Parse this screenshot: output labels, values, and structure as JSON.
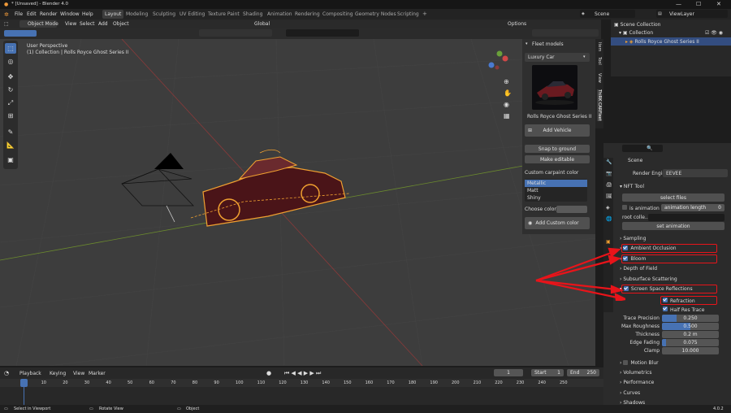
{
  "title": "* [Unsaved] - Blender 4.0",
  "menu": [
    "File",
    "Edit",
    "Render",
    "Window",
    "Help"
  ],
  "workspaces": [
    "Layout",
    "Modeling",
    "Sculpting",
    "UV Editing",
    "Texture Paint",
    "Shading",
    "Animation",
    "Rendering",
    "Compositing",
    "Geometry Nodes",
    "Scripting"
  ],
  "scene_label": "Scene",
  "viewlayer_label": "ViewLayer",
  "viewport": {
    "mode": "Object Mode",
    "menus": [
      "View",
      "Select",
      "Add",
      "Object"
    ],
    "transform": "Global",
    "options": "Options",
    "info_line1": "User Perspective",
    "info_line2": "(1) Collection | Rolls Royce Ghost Series II"
  },
  "npanel": {
    "header": "Fleet models",
    "dropdown": "Luxury Car",
    "car_name": "Rolls Royce Ghost Series II",
    "add_vehicle": "Add Vehicle",
    "snap": "Snap to ground",
    "editable": "Make editable",
    "paint_label": "Custom carpaint color",
    "paints": [
      "Metallic",
      "Matt",
      "Shiny"
    ],
    "choose_color": "Choose color:",
    "add_custom": "Add Custom color"
  },
  "vtabs": [
    "Item",
    "Tool",
    "View",
    "ThiRK CARFleet"
  ],
  "outliner": {
    "root": "Scene Collection",
    "collection": "Collection",
    "object": "Rolls Royce Ghost Series II"
  },
  "props": {
    "scene": "Scene",
    "engine_label": "Render Engine",
    "engine": "EEVEE",
    "nft_header": "NFT Tool",
    "select_files": "select files",
    "is_animation": "is animation",
    "anim_length_label": "animation length",
    "anim_length": "0",
    "root_coll": "root colle...",
    "set_animation": "set animation",
    "sections": [
      "Sampling",
      "Ambient Occlusion",
      "Bloom",
      "Depth of Field",
      "Subsurface Scattering",
      "Screen Space Reflections"
    ],
    "refraction": "Refraction",
    "half_res": "Half Res Trace",
    "fields": [
      {
        "label": "Trace Precision",
        "value": "0.250",
        "fill": 0.25
      },
      {
        "label": "Max Roughness",
        "value": "0.500",
        "fill": 0.5
      },
      {
        "label": "Thickness",
        "value": "0.2 m",
        "fill": 0
      },
      {
        "label": "Edge Fading",
        "value": "0.075",
        "fill": 0.075
      },
      {
        "label": "Clamp",
        "value": "10.000",
        "fill": 0
      }
    ],
    "sections2": [
      "Motion Blur",
      "Volumetrics",
      "Performance",
      "Curves",
      "Shadows"
    ]
  },
  "timeline": {
    "menus": [
      "Playback",
      "Keying",
      "View",
      "Marker"
    ],
    "current": "1",
    "start_label": "Start",
    "start": "1",
    "end_label": "End",
    "end": "250",
    "ticks": [
      "1",
      "10",
      "20",
      "30",
      "40",
      "50",
      "60",
      "70",
      "80",
      "90",
      "100",
      "110",
      "120",
      "130",
      "140",
      "150",
      "160",
      "170",
      "180",
      "190",
      "200",
      "210",
      "220",
      "230",
      "240",
      "250"
    ]
  },
  "status": {
    "select": "Select in Viewport",
    "rotate": "Rotate View",
    "object": "Object",
    "version": "4.0.2"
  },
  "colors": {
    "accent": "#4772b3",
    "highlight": "#e8141a",
    "orange": "#f0a030"
  }
}
